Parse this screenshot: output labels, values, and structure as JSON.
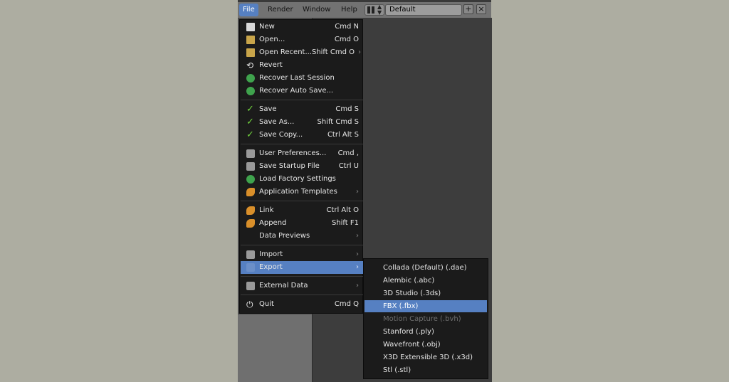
{
  "menubar": {
    "file": "File",
    "render": "Render",
    "window": "Window",
    "help": "Help",
    "layout_value": "Default"
  },
  "file_menu": {
    "items": [
      {
        "label": "New",
        "shortcut": "Cmd N",
        "icon": "new-file-icon"
      },
      {
        "label": "Open...",
        "shortcut": "Cmd O",
        "icon": "folder-icon"
      },
      {
        "label": "Open Recent...",
        "shortcut": "Shift Cmd O",
        "icon": "folder-icon"
      },
      {
        "label": "Revert",
        "shortcut": "",
        "icon": "revert-icon"
      },
      {
        "label": "Recover Last Session",
        "shortcut": "",
        "icon": "recover-icon"
      },
      {
        "label": "Recover Auto Save...",
        "shortcut": "",
        "icon": "recover-icon"
      },
      {
        "label": "Save",
        "shortcut": "Cmd S",
        "icon": "check-icon"
      },
      {
        "label": "Save As...",
        "shortcut": "Shift Cmd S",
        "icon": "check-icon"
      },
      {
        "label": "Save Copy...",
        "shortcut": "Ctrl Alt S",
        "icon": "check-icon"
      },
      {
        "label": "User Preferences...",
        "shortcut": "Cmd ,",
        "icon": "preferences-icon"
      },
      {
        "label": "Save Startup File",
        "shortcut": "Ctrl U",
        "icon": "startup-file-icon"
      },
      {
        "label": "Load Factory Settings",
        "shortcut": "",
        "icon": "factory-settings-icon"
      },
      {
        "label": "Application Templates",
        "shortcut": "",
        "icon": "templates-icon"
      },
      {
        "label": "Link",
        "shortcut": "Ctrl Alt O",
        "icon": "link-icon"
      },
      {
        "label": "Append",
        "shortcut": "Shift F1",
        "icon": "append-icon"
      },
      {
        "label": "Data Previews",
        "shortcut": "",
        "icon": ""
      },
      {
        "label": "Import",
        "shortcut": "",
        "icon": "import-icon"
      },
      {
        "label": "Export",
        "shortcut": "",
        "icon": "export-icon"
      },
      {
        "label": "External Data",
        "shortcut": "",
        "icon": "external-data-icon"
      },
      {
        "label": "Quit",
        "shortcut": "Cmd Q",
        "icon": "power-icon"
      }
    ]
  },
  "export_submenu": {
    "items": [
      {
        "label": "Collada (Default) (.dae)"
      },
      {
        "label": "Alembic (.abc)"
      },
      {
        "label": "3D Studio (.3ds)"
      },
      {
        "label": "FBX (.fbx)"
      },
      {
        "label": "Motion Capture (.bvh)"
      },
      {
        "label": "Stanford (.ply)"
      },
      {
        "label": "Wavefront (.obj)"
      },
      {
        "label": "X3D Extensible 3D (.x3d)"
      },
      {
        "label": "Stl (.stl)"
      }
    ]
  },
  "colors": {
    "highlight": "#5680c2",
    "menu_bg": "#1b1b1b",
    "page_bg": "#adada1"
  }
}
